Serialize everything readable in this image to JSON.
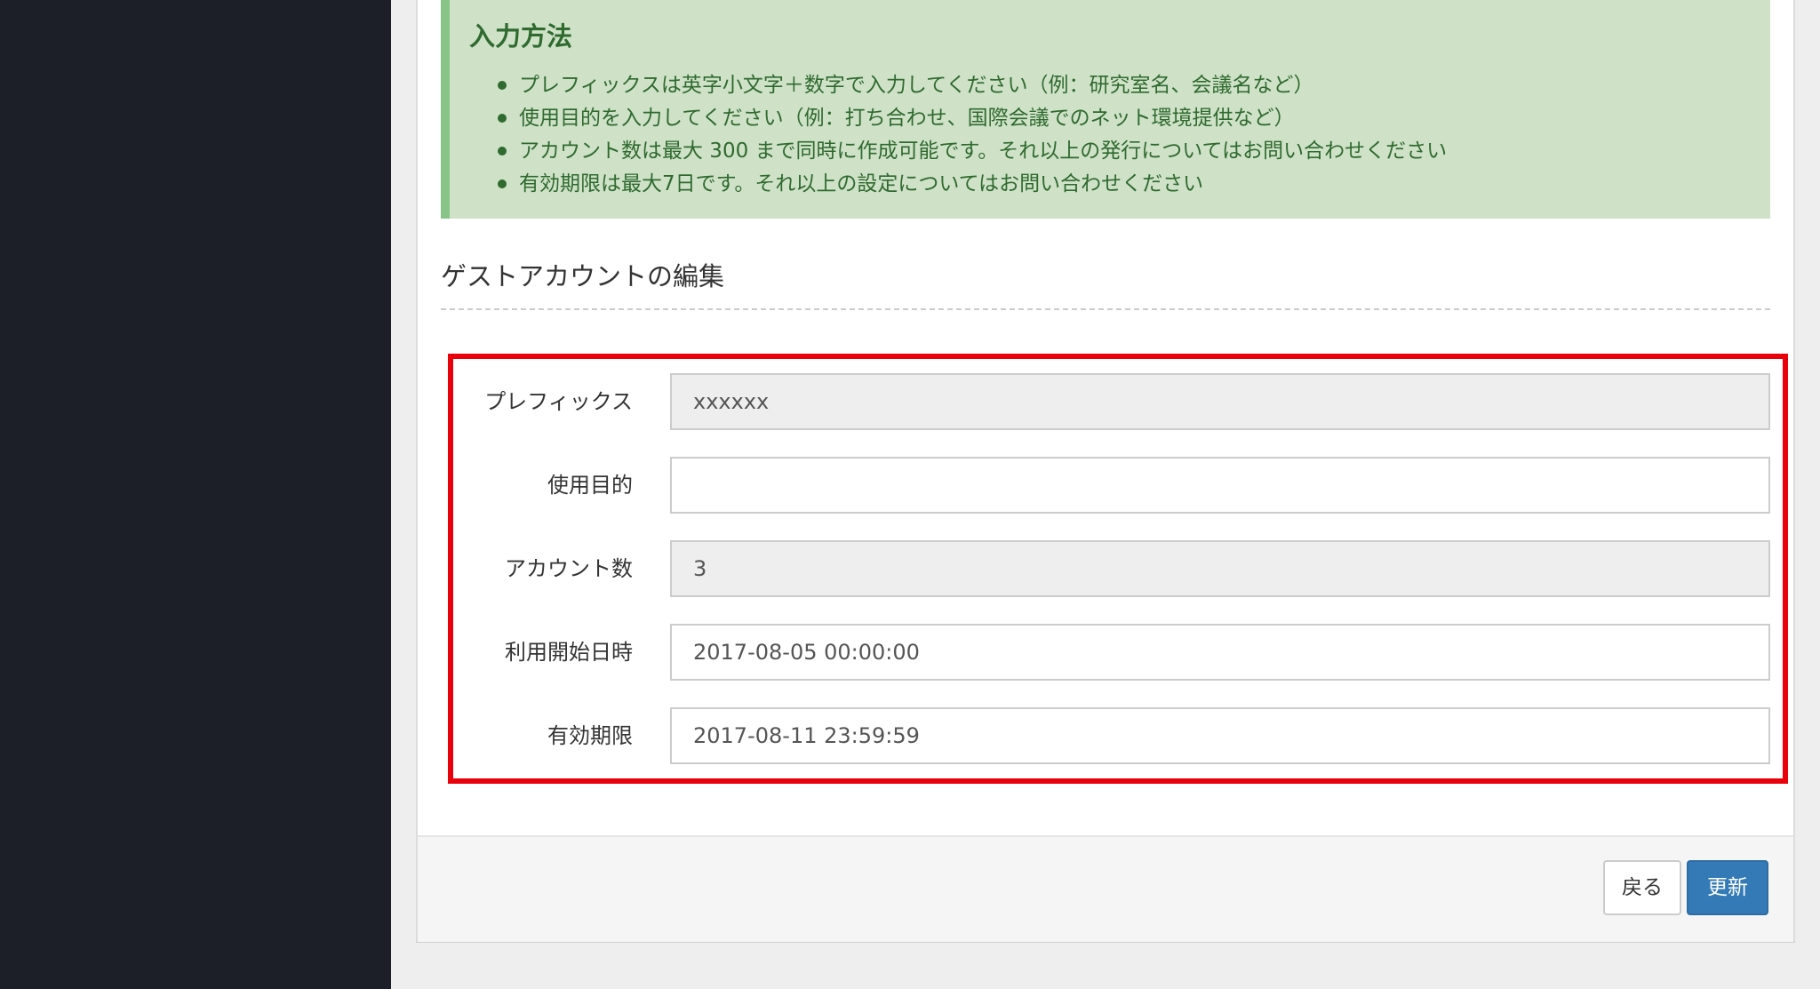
{
  "instructions": {
    "title": "入力方法",
    "items": [
      "プレフィックスは英字小文字＋数字で入力してください（例：研究室名、会議名など）",
      "使用目的を入力してください（例：打ち合わせ、国際会議でのネット環境提供など）",
      "アカウント数は最大 300 まで同時に作成可能です。それ以上の発行についてはお問い合わせください",
      "有効期限は最大7日です。それ以上の設定についてはお問い合わせください"
    ]
  },
  "form": {
    "heading": "ゲストアカウントの編集",
    "fields": [
      {
        "label": "プレフィックス",
        "value": "xxxxxx",
        "readonly": true
      },
      {
        "label": "使用目的",
        "value": "",
        "readonly": false
      },
      {
        "label": "アカウント数",
        "value": "3",
        "readonly": true
      },
      {
        "label": "利用開始日時",
        "value": "2017-08-05 00:00:00",
        "readonly": false
      },
      {
        "label": "有効期限",
        "value": "2017-08-11 23:59:59",
        "readonly": false
      }
    ]
  },
  "actions": {
    "back_label": "戻る",
    "update_label": "更新"
  },
  "colors": {
    "sidebar": "#1c1f28",
    "callout_bg": "#cfe2c8",
    "callout_text": "#2f6a2f",
    "highlight": "#e8000b",
    "primary": "#337ab7"
  }
}
